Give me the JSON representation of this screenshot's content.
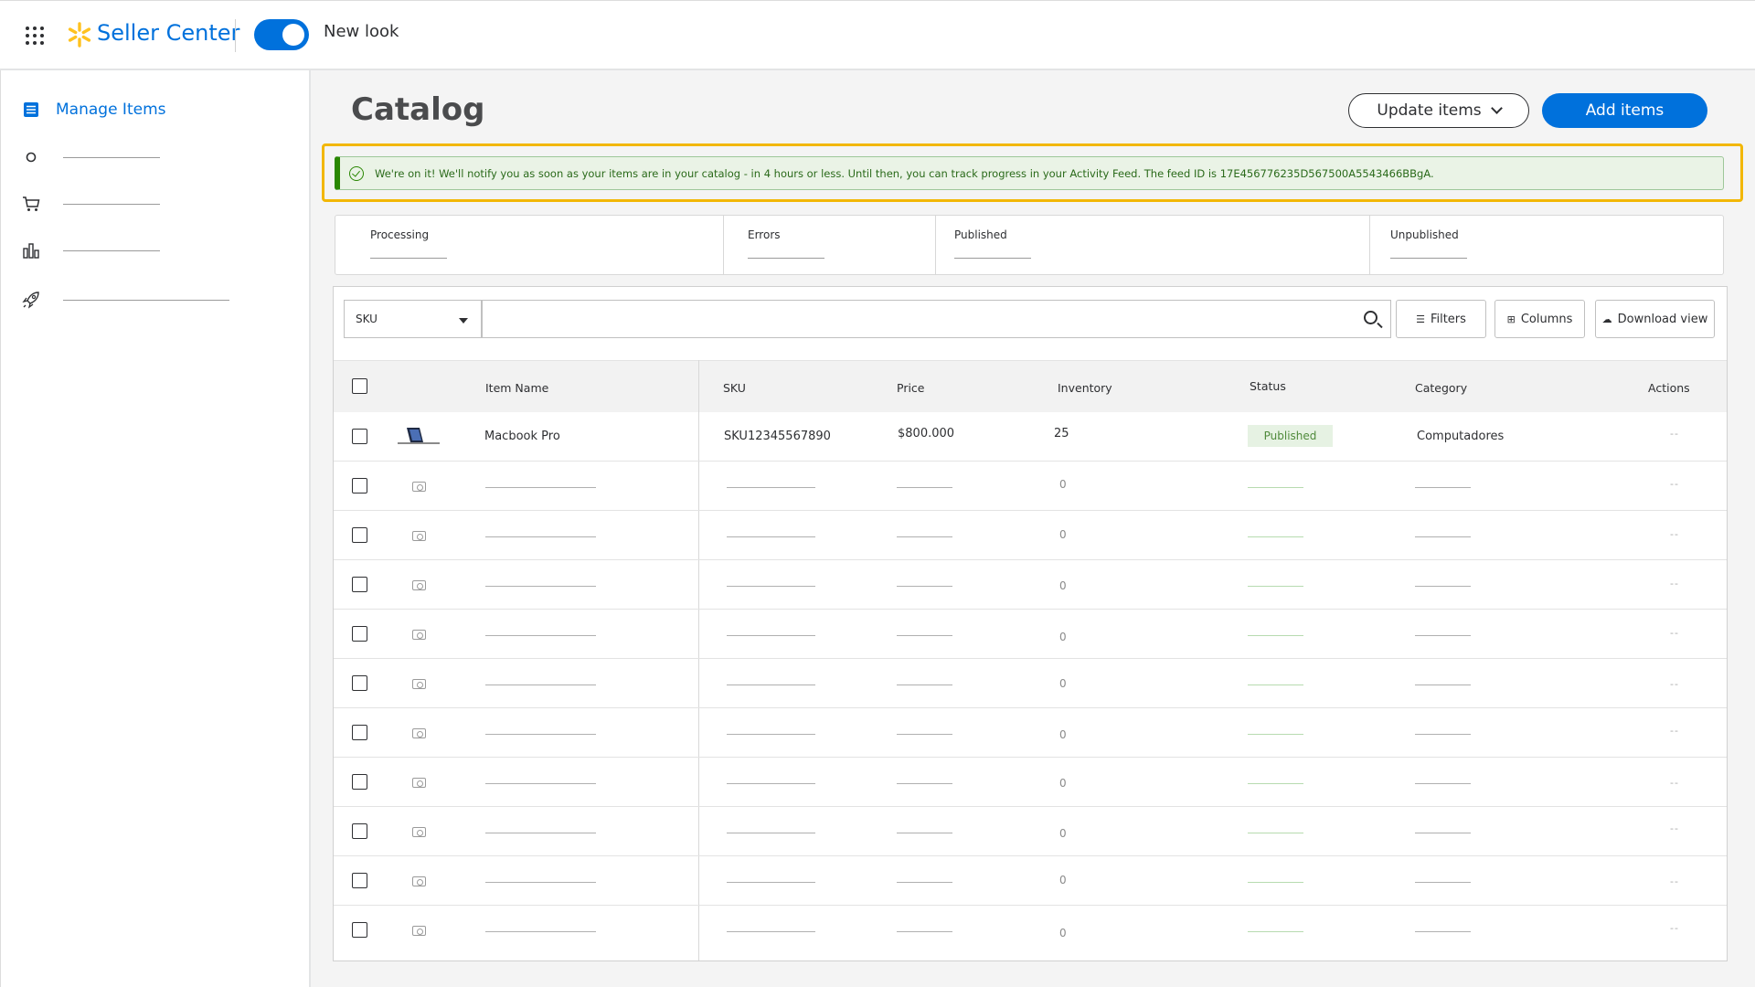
{
  "header": {
    "brand": "Seller Center",
    "toggle_label": "New look",
    "toggle_on": true,
    "brand_color": "#0071dc"
  },
  "sidebar": {
    "active_item": {
      "label": "Manage Items",
      "icon": "list-icon"
    },
    "items": [
      {
        "icon": "circle-icon"
      },
      {
        "icon": "cart-icon"
      },
      {
        "icon": "bar-chart-icon"
      },
      {
        "icon": "rocket-icon"
      }
    ]
  },
  "main": {
    "title": "Catalog",
    "update_button": "Update items",
    "add_button": "Add items"
  },
  "banner": {
    "message": "We're on it! We'll notify you as soon as your items are in your catalog - in 4 hours or less. Until then, you can track progress in your Activity Feed. The feed ID is 17E456776235D567500A5543466BBgA.",
    "color": "#2a8703"
  },
  "status_counts": {
    "processing": "Processing",
    "errors": "Errors",
    "published": "Published",
    "unpublished": "Unpublished"
  },
  "toolbar": {
    "filter_field": "SKU",
    "search_placeholder": "",
    "filters": "Filters",
    "columns": "Columns",
    "download": "Download view"
  },
  "table": {
    "headers": {
      "item_name": "Item Name",
      "sku": "SKU",
      "price": "Price",
      "inventory": "Inventory",
      "status": "Status",
      "category": "Category",
      "actions": "Actions"
    },
    "first_row": {
      "item_name": "Macbook Pro",
      "sku": "SKU12345567890",
      "price": "$800.000",
      "inventory": "25",
      "status": "Published",
      "category": "Computadores",
      "actions": "--"
    },
    "placeholder_inventory": "0",
    "placeholder_actions": "--"
  }
}
